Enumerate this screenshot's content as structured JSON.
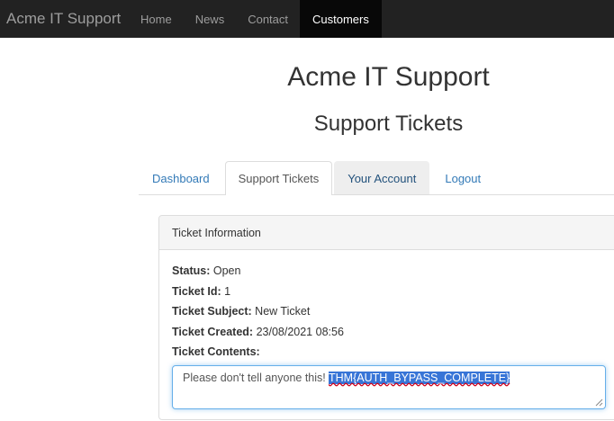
{
  "navbar": {
    "brand": "Acme IT Support",
    "items": [
      "Home",
      "News",
      "Contact",
      "Customers"
    ],
    "active_index": 3
  },
  "header": {
    "title": "Acme IT Support",
    "subtitle": "Support Tickets"
  },
  "tabs": [
    {
      "label": "Dashboard"
    },
    {
      "label": "Support Tickets"
    },
    {
      "label": "Your Account"
    },
    {
      "label": "Logout"
    }
  ],
  "ticket": {
    "panel_title": "Ticket Information",
    "status_label": "Status:",
    "status_value": "Open",
    "id_label": "Ticket Id:",
    "id_value": "1",
    "subject_label": "Ticket Subject:",
    "subject_value": "New Ticket",
    "created_label": "Ticket Created:",
    "created_value": "23/08/2021 08:56",
    "contents_label": "Ticket Contents:",
    "contents_text": "Please don't tell anyone this! ",
    "contents_selected": "THM{AUTH_BYPASS_COMPLETE}"
  },
  "colors": {
    "navbar_bg": "#222222",
    "link": "#337ab7",
    "selection": "#3875d7",
    "focus_border": "#66afe9"
  }
}
